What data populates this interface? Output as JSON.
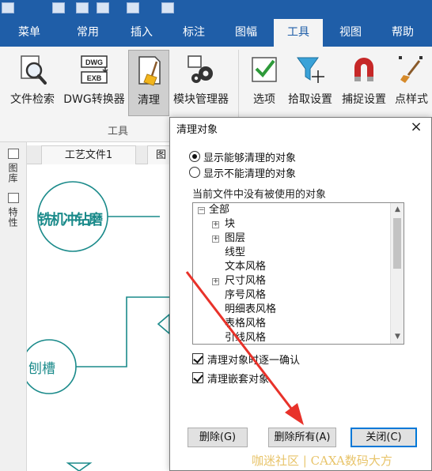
{
  "ribbon": {
    "tabs": [
      "菜单",
      "常用",
      "插入",
      "标注",
      "图幅",
      "工具",
      "视图",
      "帮助"
    ],
    "active_tab": "工具",
    "buttons": [
      {
        "label": "文件检索",
        "icon": "magnifier-file-icon"
      },
      {
        "label": "DWG转换器",
        "icon": "dwg-exb-converter-icon"
      },
      {
        "label": "清理",
        "icon": "broom-clean-icon"
      },
      {
        "label": "模块管理器",
        "icon": "gears-module-icon"
      },
      {
        "label": "选项",
        "icon": "checkmark-options-icon"
      },
      {
        "label": "拾取设置",
        "icon": "filter-pick-icon"
      },
      {
        "label": "捕捉设置",
        "icon": "magnet-snap-icon"
      },
      {
        "label": "点样式",
        "icon": "brush-point-style-icon"
      }
    ],
    "group_label": "工具"
  },
  "left_panel": {
    "library_label": "图库",
    "properties_label": "特性"
  },
  "doc_tabs": [
    "工艺文件1",
    "图"
  ],
  "drawing": {
    "circle_text_1": "铣机冲钻磨",
    "circle_text_2": "刨槽"
  },
  "dialog": {
    "title": "清理对象",
    "close": "×",
    "radio_show_cleanable": "显示能够清理的对象",
    "radio_show_not_cleanable": "显示不能清理的对象",
    "list_caption": "当前文件中没有被使用的对象",
    "tree": [
      {
        "label": "全部",
        "level": 0,
        "expander": "−"
      },
      {
        "label": "块",
        "level": 1,
        "expander": "+"
      },
      {
        "label": "图层",
        "level": 1,
        "expander": "+"
      },
      {
        "label": "线型",
        "level": 1,
        "expander": ""
      },
      {
        "label": "文本风格",
        "level": 1,
        "expander": ""
      },
      {
        "label": "尺寸风格",
        "level": 1,
        "expander": "+"
      },
      {
        "label": "序号风格",
        "level": 1,
        "expander": ""
      },
      {
        "label": "明细表风格",
        "level": 1,
        "expander": ""
      },
      {
        "label": "表格风格",
        "level": 1,
        "expander": ""
      },
      {
        "label": "引线风格",
        "level": 1,
        "expander": ""
      }
    ],
    "check_confirm_each": "清理对象时逐一确认",
    "check_nested": "清理嵌套对象",
    "btn_delete": "删除(G)",
    "btn_delete_all": "删除所有(A)",
    "btn_close": "关闭(C)"
  },
  "watermark": "咖迷社区 | CAXA数码大方",
  "colors": {
    "ribbon_blue": "#1f5ea8",
    "drawing_teal": "#1a8a8a",
    "annotation_red": "#e8322a"
  }
}
